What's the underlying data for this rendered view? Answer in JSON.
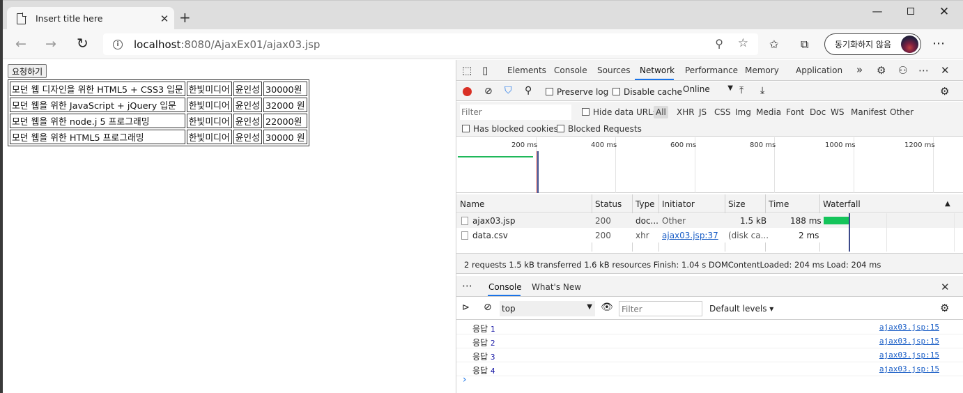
{
  "browser": {
    "tab_title": "Insert title here",
    "url_host": "localhost",
    "url_path": ":8080/AjaxEx01/ajax03.jsp",
    "sync_label": "동기화하지 않음"
  },
  "page": {
    "request_button": "요청하기",
    "books": [
      [
        "모던 웹 디자인을 위한 HTML5 + CSS3 입문",
        "한빛미디어",
        "윤인성",
        "30000원"
      ],
      [
        "모던 웹을 위한 JavaScript + jQuery 입문",
        "한빛미디어",
        "윤인성",
        "32000 원"
      ],
      [
        "모던 웹을 위한 node.j 5 프로그래밍",
        "한빛미디어",
        "윤인성",
        "22000원"
      ],
      [
        "모던 웹을 위한 HTML5 프로그래밍",
        "한빛미디어",
        "윤인성",
        "30000 원"
      ]
    ]
  },
  "devtools": {
    "tabs": [
      "Elements",
      "Console",
      "Sources",
      "Network",
      "Performance",
      "Memory",
      "Application"
    ],
    "active_tab": "Network",
    "network": {
      "preserve_log": "Preserve log",
      "disable_cache": "Disable cache",
      "throttle": "Online",
      "filter_placeholder": "Filter",
      "hide_data_urls": "Hide data URLs",
      "types": [
        "All",
        "XHR",
        "JS",
        "CSS",
        "Img",
        "Media",
        "Font",
        "Doc",
        "WS",
        "Manifest",
        "Other"
      ],
      "has_blocked_cookies": "Has blocked cookies",
      "blocked_requests": "Blocked Requests",
      "timeline_ticks": [
        "200 ms",
        "400 ms",
        "600 ms",
        "800 ms",
        "1000 ms",
        "1200 ms"
      ],
      "columns": [
        "Name",
        "Status",
        "Type",
        "Initiator",
        "Size",
        "Time",
        "Waterfall"
      ],
      "rows": [
        {
          "name": "ajax03.jsp",
          "status": "200",
          "type": "doc...",
          "initiator": "Other",
          "size": "1.5 kB",
          "time": "188 ms"
        },
        {
          "name": "data.csv",
          "status": "200",
          "type": "xhr",
          "initiator": "ajax03.jsp:37",
          "size": "(disk ca...",
          "time": "2 ms"
        }
      ],
      "summary": "2 requests  1.5 kB transferred  1.6 kB resources  Finish: 1.04 s  DOMContentLoaded: 204 ms  Load: 204 ms"
    },
    "drawer": {
      "tabs": [
        "Console",
        "What's New"
      ],
      "context": "top",
      "filter_placeholder": "Filter",
      "levels": "Default levels ▾",
      "logs": [
        {
          "label": "응답",
          "num": "1",
          "src": "ajax03.jsp:15"
        },
        {
          "label": "응답",
          "num": "2",
          "src": "ajax03.jsp:15"
        },
        {
          "label": "응답",
          "num": "3",
          "src": "ajax03.jsp:15"
        },
        {
          "label": "응답",
          "num": "4",
          "src": "ajax03.jsp:15"
        }
      ]
    }
  }
}
